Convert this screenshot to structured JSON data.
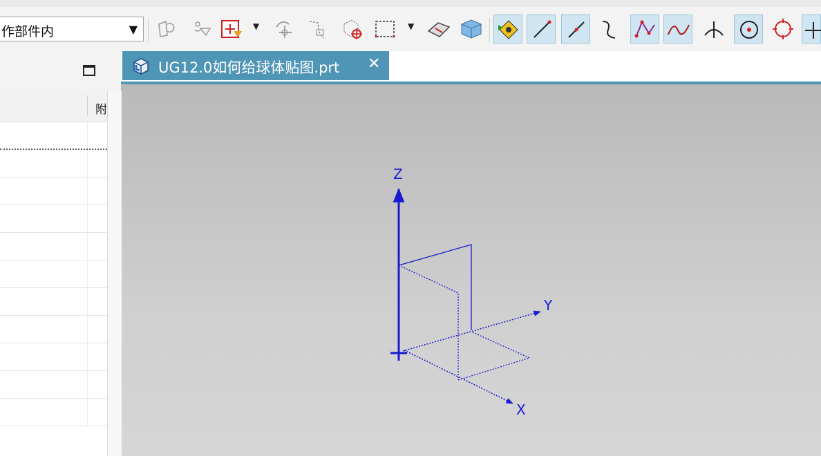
{
  "toolbar": {
    "scope_selector": {
      "value": "作部件内"
    },
    "icons": [
      "sketch-filter-icon",
      "feature-filter-icon",
      "type-filter-icon",
      "rotate-view-icon",
      "edge-select-icon",
      "box-select-icon",
      "rectangle-select-icon",
      "eraser-icon",
      "block-icon",
      "snap-point-icon",
      "line-icon",
      "segment-icon",
      "curve-icon",
      "polyline-icon",
      "spline-icon",
      "intersection-icon",
      "circle-center-icon",
      "quadrant-icon",
      "plus-icon"
    ]
  },
  "navigator": {
    "column_header": "附"
  },
  "document": {
    "tab_title": "UG12.0如何给球体贴图.prt",
    "close_symbol": "✕"
  },
  "viewport": {
    "axes": {
      "z": "Z",
      "y": "Y",
      "x": "X"
    },
    "wcs_color": "#1a1ad0"
  }
}
